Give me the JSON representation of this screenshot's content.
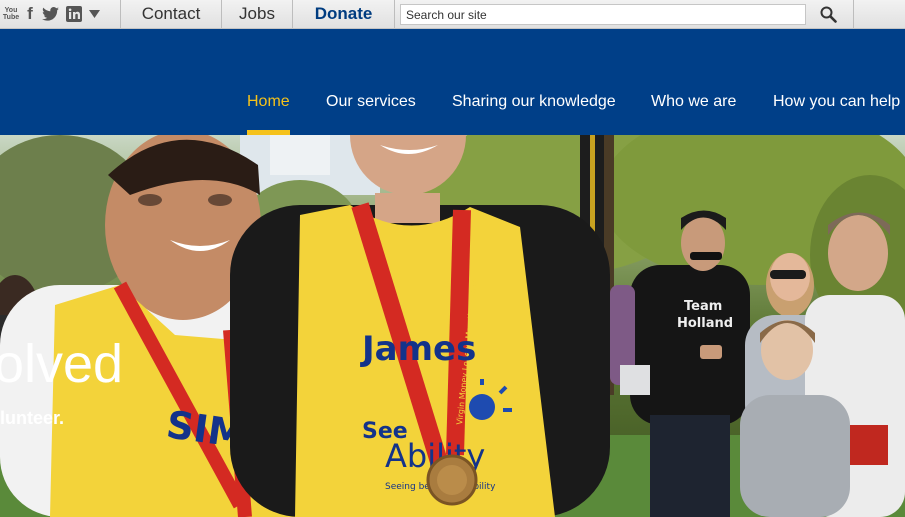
{
  "social": {
    "youtube_top": "You",
    "youtube_bottom": "Tube",
    "facebook": "f"
  },
  "toplinks": {
    "contact": "Contact",
    "jobs": "Jobs",
    "donate": "Donate"
  },
  "search": {
    "placeholder": "Search our site"
  },
  "nav": {
    "items": [
      {
        "label": "Home",
        "active": true
      },
      {
        "label": "Our services"
      },
      {
        "label": "Sharing our knowledge"
      },
      {
        "label": "Who we are"
      },
      {
        "label": "How you can help"
      }
    ]
  },
  "hero": {
    "title": "olved",
    "subtitle": "lunteer.",
    "bib_left": "SIMON",
    "bib_right": "James",
    "brand_see": "See",
    "brand_ability": "Ability",
    "brand_tagline": "Seeing beyond disability",
    "shirt_line1": "Team",
    "shirt_line2": "Holland",
    "ribbon_text": "Virgin Money London Marathon 2014"
  },
  "colors": {
    "header_bg": "#003f88",
    "accent": "#f5c21b",
    "donate": "#003c80",
    "bib_yellow": "#f3d33a",
    "bib_text": "#13338a"
  }
}
